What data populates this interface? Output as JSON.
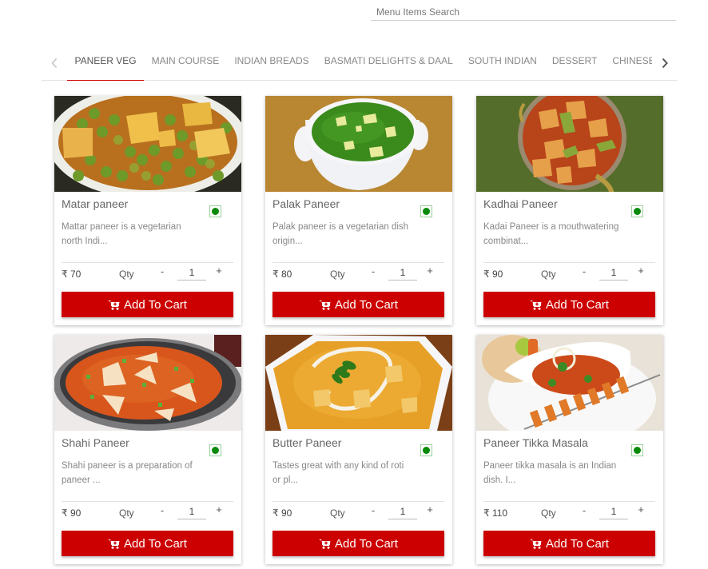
{
  "search": {
    "placeholder": "Menu Items Search",
    "value": ""
  },
  "tabs": {
    "prev_icon": "chevron-left-icon",
    "next_icon": "chevron-right-icon",
    "items": [
      {
        "label": "PANEER VEG",
        "active": true
      },
      {
        "label": "MAIN COURSE",
        "active": false
      },
      {
        "label": "INDIAN BREADS",
        "active": false
      },
      {
        "label": "BASMATI DELIGHTS & DAAL",
        "active": false
      },
      {
        "label": "SOUTH INDIAN",
        "active": false
      },
      {
        "label": "DESSERT",
        "active": false
      },
      {
        "label": "CHINESE &",
        "active": false
      }
    ]
  },
  "colors": {
    "accent": "#cc0000",
    "veg_indicator": "#0a8a0a"
  },
  "labels": {
    "qty": "Qty",
    "minus": "-",
    "plus": "+",
    "add_to_cart": "Add To Cart",
    "cart_icon": "cart-plus-icon",
    "veg_icon": "veg-indicator-icon"
  },
  "products": [
    {
      "name": "Matar paneer",
      "description": "Mattar paneer is a vegetarian north Indi...",
      "price": "₹ 70",
      "qty": "1",
      "veg": true,
      "image": "matar-paneer-photo"
    },
    {
      "name": "Palak Paneer",
      "description": "Palak paneer is a vegetarian dish origin...",
      "price": "₹ 80",
      "qty": "1",
      "veg": true,
      "image": "palak-paneer-photo"
    },
    {
      "name": "Kadhai Paneer",
      "description": "Kadai Paneer is a mouthwatering combinat...",
      "price": "₹ 90",
      "qty": "1",
      "veg": true,
      "image": "kadhai-paneer-photo"
    },
    {
      "name": "Shahi Paneer",
      "description": "Shahi paneer is a preparation of paneer ...",
      "price": "₹ 90",
      "qty": "1",
      "veg": true,
      "image": "shahi-paneer-photo"
    },
    {
      "name": "Butter Paneer",
      "description": "Tastes great with any kind of roti or pl...",
      "price": "₹ 90",
      "qty": "1",
      "veg": true,
      "image": "butter-paneer-photo"
    },
    {
      "name": "Paneer Tikka Masala",
      "description": "Paneer tikka masala is an Indian dish. I...",
      "price": "₹ 110",
      "qty": "1",
      "veg": true,
      "image": "paneer-tikka-masala-photo"
    }
  ]
}
